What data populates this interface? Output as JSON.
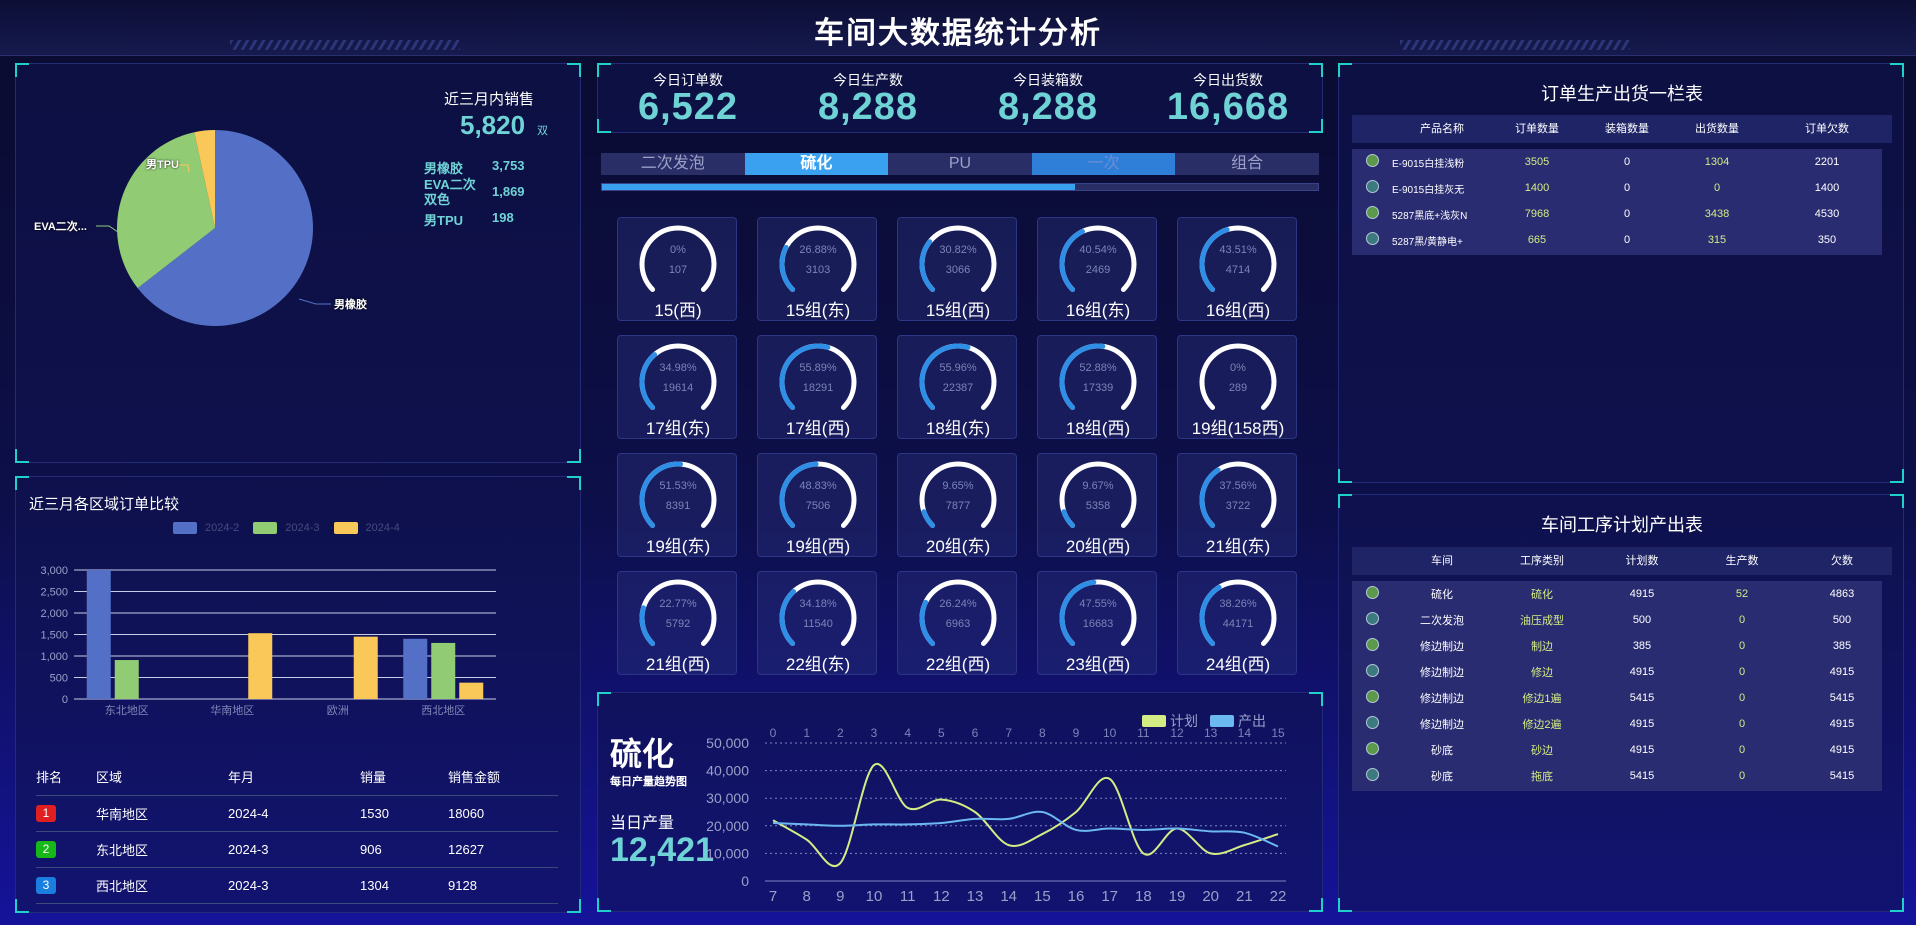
{
  "header": {
    "title": "车间大数据统计分析"
  },
  "sales": {
    "title": "近三月内销售",
    "total": "5,820",
    "unit": "双",
    "legend": [
      {
        "name": "男橡胶",
        "value": "3,753"
      },
      {
        "name": "EVA二次双色",
        "value": "1,869"
      },
      {
        "name": "男TPU",
        "value": "198"
      }
    ],
    "pie_labels": [
      "男TPU",
      "EVA二次...",
      "男橡胶"
    ],
    "colors": [
      "#5470c6",
      "#91cc75",
      "#fac858"
    ]
  },
  "region_chart": {
    "title": "近三月各区域订单比较",
    "legend": [
      "2024-2",
      "2024-3",
      "2024-4"
    ]
  },
  "rank_table": {
    "headers": [
      "排名",
      "区域",
      "年月",
      "销量",
      "销售金额"
    ],
    "rows": [
      {
        "rank": "1",
        "region": "华南地区",
        "month": "2024-4",
        "qty": "1530",
        "amount": "18060",
        "color": "#e02020"
      },
      {
        "rank": "2",
        "region": "东北地区",
        "month": "2024-3",
        "qty": "906",
        "amount": "12627",
        "color": "#18b818"
      },
      {
        "rank": "3",
        "region": "西北地区",
        "month": "2024-3",
        "qty": "1304",
        "amount": "9128",
        "color": "#1a7ee0"
      }
    ]
  },
  "kpis": [
    {
      "label": "今日订单数",
      "value": "6,522"
    },
    {
      "label": "今日生产数",
      "value": "8,288"
    },
    {
      "label": "今日装箱数",
      "value": "8,288"
    },
    {
      "label": "今日出货数",
      "value": "16,668"
    }
  ],
  "tabs": [
    "二次发泡",
    "硫化",
    "PU",
    "一次",
    "组合"
  ],
  "tab_progress": 0.66,
  "gauges": [
    {
      "pct": "0%",
      "num": "107",
      "name": "15(西)",
      "fraction": 0
    },
    {
      "pct": "26.88%",
      "num": "3103",
      "name": "15组(东)",
      "fraction": 0.2688
    },
    {
      "pct": "30.82%",
      "num": "3066",
      "name": "15组(西)",
      "fraction": 0.3082
    },
    {
      "pct": "40.54%",
      "num": "2469",
      "name": "16组(东)",
      "fraction": 0.4054
    },
    {
      "pct": "43.51%",
      "num": "4714",
      "name": "16组(西)",
      "fraction": 0.4351
    },
    {
      "pct": "34.98%",
      "num": "19614",
      "name": "17组(东)",
      "fraction": 0.3498
    },
    {
      "pct": "55.89%",
      "num": "18291",
      "name": "17组(西)",
      "fraction": 0.5589
    },
    {
      "pct": "55.96%",
      "num": "22387",
      "name": "18组(东)",
      "fraction": 0.5596
    },
    {
      "pct": "52.88%",
      "num": "17339",
      "name": "18组(西)",
      "fraction": 0.5288
    },
    {
      "pct": "0%",
      "num": "289",
      "name": "19组(158西)",
      "fraction": 0
    },
    {
      "pct": "51.53%",
      "num": "8391",
      "name": "19组(东)",
      "fraction": 0.5153
    },
    {
      "pct": "48.83%",
      "num": "7506",
      "name": "19组(西)",
      "fraction": 0.4883
    },
    {
      "pct": "9.65%",
      "num": "7877",
      "name": "20组(东)",
      "fraction": 0.0965
    },
    {
      "pct": "9.67%",
      "num": "5358",
      "name": "20组(西)",
      "fraction": 0.0967
    },
    {
      "pct": "37.56%",
      "num": "3722",
      "name": "21组(东)",
      "fraction": 0.3756
    },
    {
      "pct": "22.77%",
      "num": "5792",
      "name": "21组(西)",
      "fraction": 0.2277
    },
    {
      "pct": "34.18%",
      "num": "11540",
      "name": "22组(东)",
      "fraction": 0.3418
    },
    {
      "pct": "26.24%",
      "num": "6963",
      "name": "22组(西)",
      "fraction": 0.2624
    },
    {
      "pct": "47.55%",
      "num": "16683",
      "name": "23组(西)",
      "fraction": 0.4755
    },
    {
      "pct": "38.26%",
      "num": "44171",
      "name": "24组(西)",
      "fraction": 0.3826
    }
  ],
  "trend": {
    "title": "硫化",
    "subtitle": "每日产量趋势图",
    "today_label": "当日产量",
    "today_value": "12,421"
  },
  "order_table": {
    "title": "订单生产出货一栏表",
    "headers": [
      "产品名称",
      "订单数量",
      "装箱数量",
      "出货数量",
      "订单欠数"
    ],
    "rows": [
      {
        "name": "E-9015白挂浅粉",
        "order": "3505",
        "packed": "0",
        "shipped": "1304",
        "owed": "2201",
        "dot": "#5b9a4a"
      },
      {
        "name": "E-9015白挂灰无",
        "order": "1400",
        "packed": "0",
        "shipped": "0",
        "owed": "1400",
        "dot": "#3b7a7e"
      },
      {
        "name": "5287黑底+浅灰N",
        "order": "7968",
        "packed": "0",
        "shipped": "3438",
        "owed": "4530",
        "dot": "#5b9a4a"
      },
      {
        "name": "5287黑/黄静电+",
        "order": "665",
        "packed": "0",
        "shipped": "315",
        "owed": "350",
        "dot": "#3b7a7e"
      }
    ]
  },
  "process_table": {
    "title": "车间工序计划产出表",
    "headers": [
      "车间",
      "工序类别",
      "计划数",
      "生产数",
      "欠数"
    ],
    "rows": [
      {
        "shop": "硫化",
        "type": "硫化",
        "plan": "4915",
        "made": "52",
        "owed": "4863",
        "dot": "#5b9a4a"
      },
      {
        "shop": "二次发泡",
        "type": "油压成型",
        "plan": "500",
        "made": "0",
        "owed": "500",
        "dot": "#3b7a7e"
      },
      {
        "shop": "修边制边",
        "type": "制边",
        "plan": "385",
        "made": "0",
        "owed": "385",
        "dot": "#5b9a4a"
      },
      {
        "shop": "修边制边",
        "type": "修边",
        "plan": "4915",
        "made": "0",
        "owed": "4915",
        "dot": "#3b7a7e"
      },
      {
        "shop": "修边制边",
        "type": "修边1遍",
        "plan": "5415",
        "made": "0",
        "owed": "5415",
        "dot": "#5b9a4a"
      },
      {
        "shop": "修边制边",
        "type": "修边2遍",
        "plan": "4915",
        "made": "0",
        "owed": "4915",
        "dot": "#3b7a7e"
      },
      {
        "shop": "砂底",
        "type": "砂边",
        "plan": "4915",
        "made": "0",
        "owed": "4915",
        "dot": "#5b9a4a"
      },
      {
        "shop": "砂底",
        "type": "拖底",
        "plan": "5415",
        "made": "0",
        "owed": "5415",
        "dot": "#3b7a7e"
      }
    ]
  },
  "chart_data": [
    {
      "type": "pie",
      "labels": [
        "男橡胶",
        "EVA二次双色",
        "男TPU"
      ],
      "values": [
        3753,
        1869,
        198
      ]
    },
    {
      "type": "bar",
      "title": "近三月各区域订单比较",
      "categories": [
        "东北地区",
        "华南地区",
        "欧洲",
        "西北地区"
      ],
      "series": [
        {
          "name": "2024-2",
          "values": [
            3000,
            0,
            0,
            1400
          ]
        },
        {
          "name": "2024-3",
          "values": [
            906,
            0,
            0,
            1304
          ]
        },
        {
          "name": "2024-4",
          "values": [
            0,
            1530,
            1450,
            380
          ]
        }
      ],
      "yticks": [
        "0",
        "500",
        "1,000",
        "1,500",
        "2,000",
        "2,500",
        "3,000"
      ],
      "ylim": [
        0,
        3000
      ],
      "colors": [
        "#5470c6",
        "#91cc75",
        "#fac858"
      ]
    },
    {
      "type": "line",
      "x": [
        7,
        8,
        9,
        10,
        11,
        12,
        13,
        14,
        15,
        16,
        17,
        18,
        19,
        20,
        21,
        22
      ],
      "top_ticks": [
        "0",
        "1",
        "2",
        "3",
        "4",
        "5",
        "6",
        "7",
        "8",
        "9",
        "10",
        "11",
        "12",
        "13",
        "14",
        "15"
      ],
      "yticks": [
        "0",
        "10,000",
        "20,000",
        "30,000",
        "40,000",
        "50,000"
      ],
      "ylim": [
        0,
        50000
      ],
      "series": [
        {
          "name": "计划",
          "color": "#d4ec84",
          "values": [
            22000,
            15000,
            6500,
            42000,
            26500,
            29500,
            25000,
            13000,
            17000,
            25000,
            37000,
            10000,
            19000,
            10000,
            13000,
            17000
          ]
        },
        {
          "name": "产出",
          "color": "#6cb8f0",
          "values": [
            21000,
            20500,
            20000,
            20500,
            20500,
            21000,
            22500,
            22500,
            25000,
            18500,
            19000,
            18500,
            19000,
            18000,
            17500,
            12500
          ]
        }
      ]
    }
  ]
}
